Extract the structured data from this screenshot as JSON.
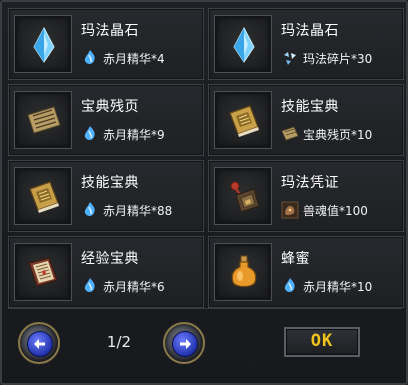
{
  "colors": {
    "accent_gold": "#f0c21c",
    "panel_bg": "#1d2024",
    "cell_border": "#3e4146",
    "arrow_blue": "#3a4fe0"
  },
  "items": [
    {
      "name": "玛法晶石",
      "icon": "crystal-icon",
      "cost_icon": "essence-icon",
      "cost": "赤月精华*4"
    },
    {
      "name": "玛法晶石",
      "icon": "crystal-icon",
      "cost_icon": "shard-icon",
      "cost": "玛法碎片*30"
    },
    {
      "name": "宝典残页",
      "icon": "scroll-page-icon",
      "cost_icon": "essence-icon",
      "cost": "赤月精华*9"
    },
    {
      "name": "技能宝典",
      "icon": "skill-book-icon",
      "cost_icon": "scroll-page-icon",
      "cost": "宝典残页*10"
    },
    {
      "name": "技能宝典",
      "icon": "skill-book-icon",
      "cost_icon": "essence-icon",
      "cost": "赤月精华*88"
    },
    {
      "name": "玛法凭证",
      "icon": "certificate-icon",
      "cost_icon": "beast-soul-icon",
      "cost": "兽魂值*100"
    },
    {
      "name": "经验宝典",
      "icon": "exp-book-icon",
      "cost_icon": "essence-icon",
      "cost": "赤月精华*6"
    },
    {
      "name": "蜂蜜",
      "icon": "honey-bottle-icon",
      "cost_icon": "essence-icon",
      "cost": "赤月精华*10"
    }
  ],
  "pager": {
    "page": "1/2"
  },
  "ok_label": "OK"
}
